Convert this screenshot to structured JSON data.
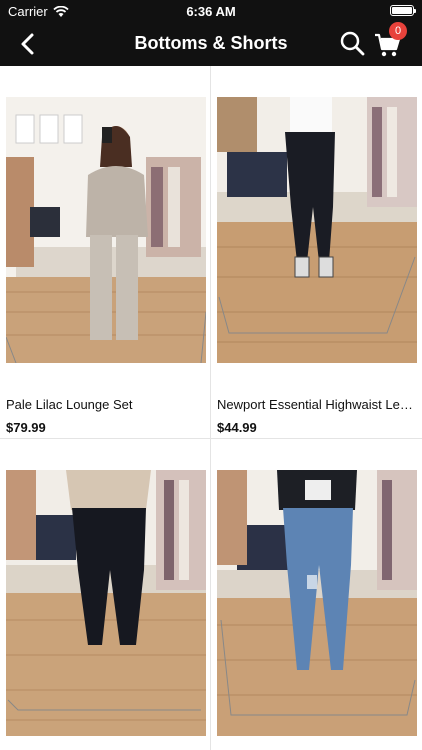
{
  "status_bar": {
    "carrier": "Carrier",
    "time": "6:36 AM"
  },
  "nav": {
    "title": "Bottoms & Shorts",
    "cart_count": "0"
  },
  "products": [
    {
      "name": "Pale Lilac Lounge Set",
      "price": "$79.99"
    },
    {
      "name": "Newport Essential Highwaist Legg...",
      "price": "$44.99"
    },
    {
      "name": "",
      "price": ""
    },
    {
      "name": "",
      "price": ""
    }
  ],
  "colors": {
    "nav_bg": "#111111",
    "badge": "#e8423b",
    "floor": "#c9a27a"
  }
}
